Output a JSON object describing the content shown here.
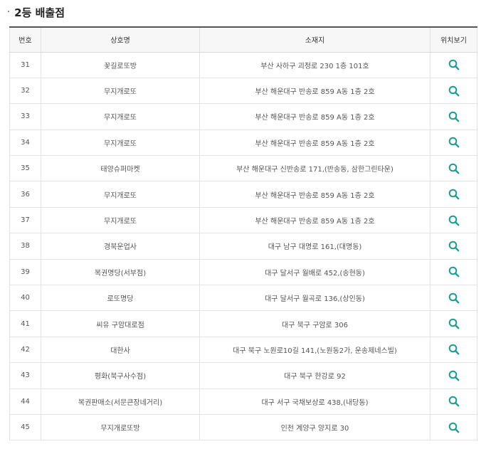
{
  "section": {
    "bullet": "·",
    "title": "2등 배출점"
  },
  "table": {
    "headers": {
      "no": "번호",
      "name": "상호명",
      "address": "소재지",
      "location": "위치보기"
    },
    "rows": [
      {
        "no": "31",
        "name": "꽃길로또방",
        "address": "부산 사하구 괴정로 230 1층 101호"
      },
      {
        "no": "32",
        "name": "무지개로또",
        "address": "부산 해운대구 반송로 859 A동 1층 2호"
      },
      {
        "no": "33",
        "name": "무지개로또",
        "address": "부산 해운대구 반송로 859 A동 1층 2호"
      },
      {
        "no": "34",
        "name": "무지개로또",
        "address": "부산 해운대구 반송로 859 A동 1층 2호"
      },
      {
        "no": "35",
        "name": "태양슈퍼마켓",
        "address": "부산 해운대구 신반송로 171,(반송동, 삼한그린타운)"
      },
      {
        "no": "36",
        "name": "무지개로또",
        "address": "부산 해운대구 반송로 859 A동 1층 2호"
      },
      {
        "no": "37",
        "name": "무지개로또",
        "address": "부산 해운대구 반송로 859 A동 1층 2호"
      },
      {
        "no": "38",
        "name": "경북운업사",
        "address": "대구 남구 대명로 161,(대명동)"
      },
      {
        "no": "39",
        "name": "복권명당(서부점)",
        "address": "대구 달서구 월배로 452,(송현동)"
      },
      {
        "no": "40",
        "name": "로또명당",
        "address": "대구 달서구 월곡로 136,(상인동)"
      },
      {
        "no": "41",
        "name": "씨유 구암대로점",
        "address": "대구 북구 구암로 306"
      },
      {
        "no": "42",
        "name": "대한사",
        "address": "대구 북구 노원로10길 141,(노원동2가, 운송제네스빌)"
      },
      {
        "no": "43",
        "name": "평화(북구사수점)",
        "address": "대구 북구 한강로 92"
      },
      {
        "no": "44",
        "name": "복권판매소(서문큰장네거리)",
        "address": "대구 서구 국채보상로 438,(내당동)"
      },
      {
        "no": "45",
        "name": "무지개로또방",
        "address": "인천 계양구 양지로 30"
      }
    ]
  },
  "icons": {
    "location": "search-icon",
    "accent_color": "#1a9e8f"
  }
}
